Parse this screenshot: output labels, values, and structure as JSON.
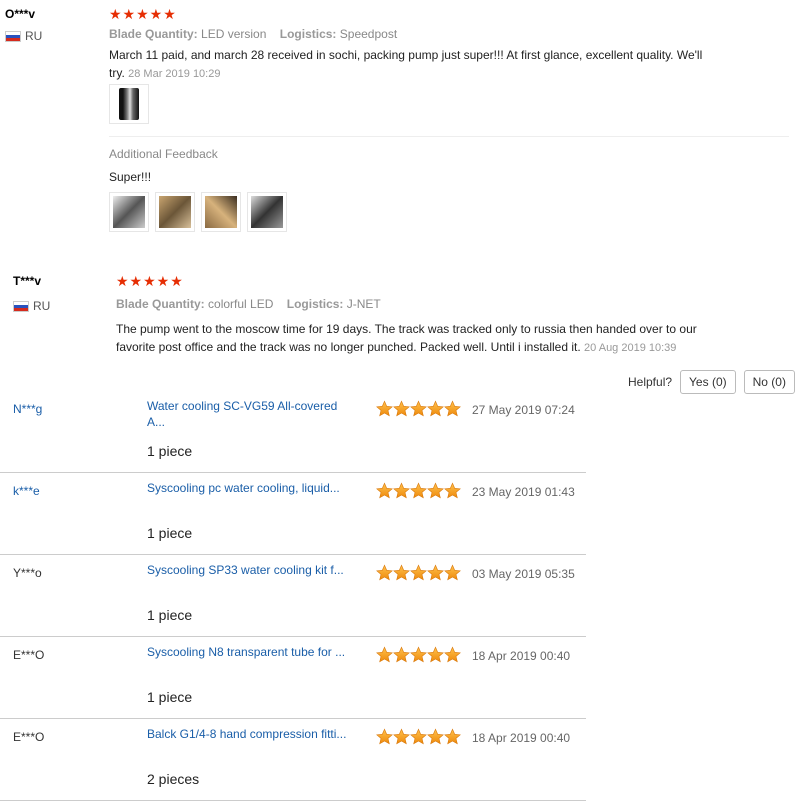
{
  "reviews": [
    {
      "user": "O***v",
      "country": "RU",
      "rating_stars": "★★★★★",
      "rating": 5,
      "blade_label": "Blade Quantity:",
      "blade_value": "LED version",
      "logistics_label": "Logistics:",
      "logistics_value": "Speedpost",
      "text": "March 11 paid, and march 28 received in sochi, packing pump just super!!! At first glance, excellent quality. We'll try.",
      "date": "28 Mar 2019 10:29",
      "additional_label": "Additional Feedback",
      "additional_text": "Super!!!"
    },
    {
      "user": "T***v",
      "country": "RU",
      "rating_stars": "★★★★★",
      "rating": 5,
      "blade_label": "Blade Quantity:",
      "blade_value": "colorful LED",
      "logistics_label": "Logistics:",
      "logistics_value": "J-NET",
      "text": "The pump went to the moscow time for 19 days. The track was tracked only to russia then handed over to our favorite post office and the track was no longer punched. Packed well. Until i installed it.",
      "date": "20 Aug 2019 10:39"
    }
  ],
  "helpful": {
    "label": "Helpful?",
    "yes": "Yes (0)",
    "no": "No (0)"
  },
  "transactions": [
    {
      "user": "N***g",
      "user_link": true,
      "product": "Water cooling SC-VG59 All-covered A...",
      "rating": 5,
      "date": "27 May 2019 07:24",
      "quantity": "1 piece"
    },
    {
      "user": "k***e",
      "user_link": true,
      "product": "Syscooling pc water cooling, liquid...",
      "rating": 5,
      "date": "23 May 2019 01:43",
      "quantity": "1 piece"
    },
    {
      "user": "Y***o",
      "user_link": false,
      "product": "Syscooling SP33 water cooling kit f...",
      "rating": 5,
      "date": "03 May 2019 05:35",
      "quantity": "1 piece"
    },
    {
      "user": "E***O",
      "user_link": false,
      "product": "Syscooling N8 transparent tube for ...",
      "rating": 5,
      "date": "18 Apr 2019 00:40",
      "quantity": "1 piece"
    },
    {
      "user": "E***O",
      "user_link": false,
      "product": "Balck G1/4-8 hand compression fitti...",
      "rating": 5,
      "date": "18 Apr 2019 00:40",
      "quantity": "2 pieces"
    }
  ],
  "colors": {
    "star_red": "#e62e04",
    "star_gold": "#f4a21a",
    "link_blue": "#1a5ea8"
  }
}
